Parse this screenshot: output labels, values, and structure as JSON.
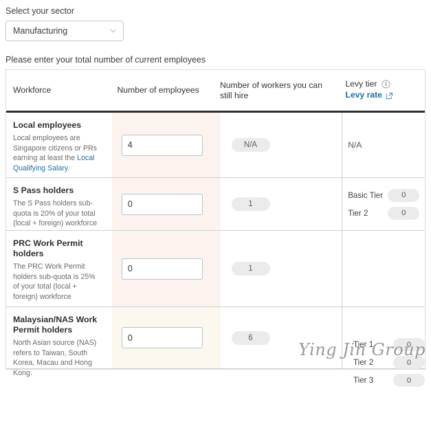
{
  "sector": {
    "label": "Select your sector",
    "selected": "Manufacturing",
    "chevron_icon": "chevron-down-icon"
  },
  "table_intro": "Please enter your total number of current employees",
  "table": {
    "headers": {
      "workforce": "Workforce",
      "number_of_employees": "Number of employees",
      "workers_you_can_still_hire": "Number of workers you can still hire",
      "levy_tier": "Levy tier",
      "levy_rate": "Levy rate",
      "info_icon": "info-circle-icon",
      "external_link_icon": "external-link-icon"
    },
    "rows": [
      {
        "title": "Local employees",
        "desc_before_link": "Local employees are Singapore citizens or PRs earning at least the ",
        "desc_link": "Local Qualifying Salary",
        "desc_after_link": ".",
        "input_value": "4",
        "hire_pill": "N/A",
        "levy_na": "N/A",
        "tiers": []
      },
      {
        "title": "S Pass holders",
        "desc": "The S Pass holders sub-quota is 20% of your total (local + foreign) workforce",
        "input_value": "0",
        "hire_pill": "1",
        "tiers": [
          {
            "name": "Basic Tier",
            "value": "0"
          },
          {
            "name": "Tier 2",
            "value": "0"
          }
        ]
      },
      {
        "title": "PRC Work Permit holders",
        "desc": "The PRC Work Permit holders sub-quota is 25% of your total (local + foreign) workforce",
        "input_value": "0",
        "hire_pill": "1",
        "tiers": []
      },
      {
        "title": "Malaysian/NAS Work Permit holders",
        "desc": "North Asian source (NAS) refers to Taiwan, South Korea, Macau and Hong Kong.",
        "input_value": "0",
        "hire_pill": "6",
        "tiers": []
      }
    ],
    "merged_tiers": [
      {
        "name": "Tier 1",
        "value": "0"
      },
      {
        "name": "Tier 2",
        "value": "0"
      },
      {
        "name": "Tier 3",
        "value": "0"
      }
    ]
  },
  "watermark": "Ying Jin Group",
  "colors": {
    "link": "#1c6ea8",
    "highlight_band": "#fdf3ee",
    "highlight_band_last": "#fdf8ef",
    "pill_bg": "#ebebeb",
    "header_rule": "#2e2e2e"
  }
}
